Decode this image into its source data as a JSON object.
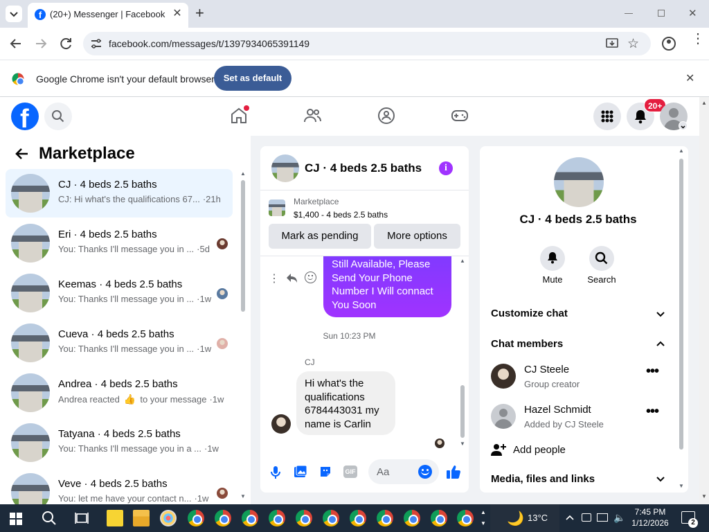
{
  "browser": {
    "tab_title": "(20+) Messenger | Facebook",
    "url": "facebook.com/messages/t/1397934065391149",
    "infobar_text": "Google Chrome isn't your default browser",
    "set_default_label": "Set as default"
  },
  "header": {
    "notif_badge": "20+"
  },
  "left": {
    "title": "Marketplace",
    "conversations": [
      {
        "title": "CJ · 4 beds 2.5 baths",
        "snippet": "CJ: Hi what's the qualifications 67...",
        "time": "·21h"
      },
      {
        "title": "Eri · 4 beds 2.5 baths",
        "snippet": "You: Thanks I'll message you in ...",
        "time": "·5d"
      },
      {
        "title": "Keemas · 4 beds 2.5 baths",
        "snippet": "You: Thanks I'll message you in ...",
        "time": "·1w"
      },
      {
        "title": "Cueva · 4 beds 2.5 baths",
        "snippet": "You: Thanks I'll message you in ...",
        "time": "·1w"
      },
      {
        "title": "Andrea · 4 beds 2.5 baths",
        "snippet": "Andrea reacted",
        "snippet2": "to your message",
        "time": "·1w"
      },
      {
        "title": "Tatyana · 4 beds 2.5 baths",
        "snippet": "You: Thanks I'll message you in a ...",
        "time": "·1w"
      },
      {
        "title": "Veve · 4 beds 2.5 baths",
        "snippet": "You: let me have your contact n...",
        "time": "·1w"
      }
    ]
  },
  "chat": {
    "title": "CJ · 4 beds 2.5 baths",
    "listing_label": "Marketplace",
    "listing_price": "$1,400 - 4 beds 2.5 baths",
    "mark_pending": "Mark as pending",
    "more_options": "More options",
    "sent_message": "Still Available, Please Send Your Phone Number I Will connact You Soon",
    "timestamp": "Sun 10:23 PM",
    "sender_name": "CJ",
    "received_message": "Hi what's the qualifications 6784443031 my name is Carlin",
    "input_placeholder": "Aa"
  },
  "right": {
    "title": "CJ · 4 beds 2.5 baths",
    "mute_label": "Mute",
    "search_label": "Search",
    "customize_chat": "Customize chat",
    "chat_members": "Chat members",
    "members": [
      {
        "name": "CJ Steele",
        "role": "Group creator"
      },
      {
        "name": "Hazel Schmidt",
        "role": "Added by CJ Steele"
      }
    ],
    "add_people": "Add people",
    "media_files": "Media, files and links"
  },
  "taskbar": {
    "weather": "13°C",
    "time": "7:45 PM",
    "date": "1/12/2026",
    "notif_count": "2"
  },
  "colors": {
    "fb_blue": "#0866ff",
    "messenger_purple": "#a033ff",
    "notif_red": "#e41e3f"
  }
}
